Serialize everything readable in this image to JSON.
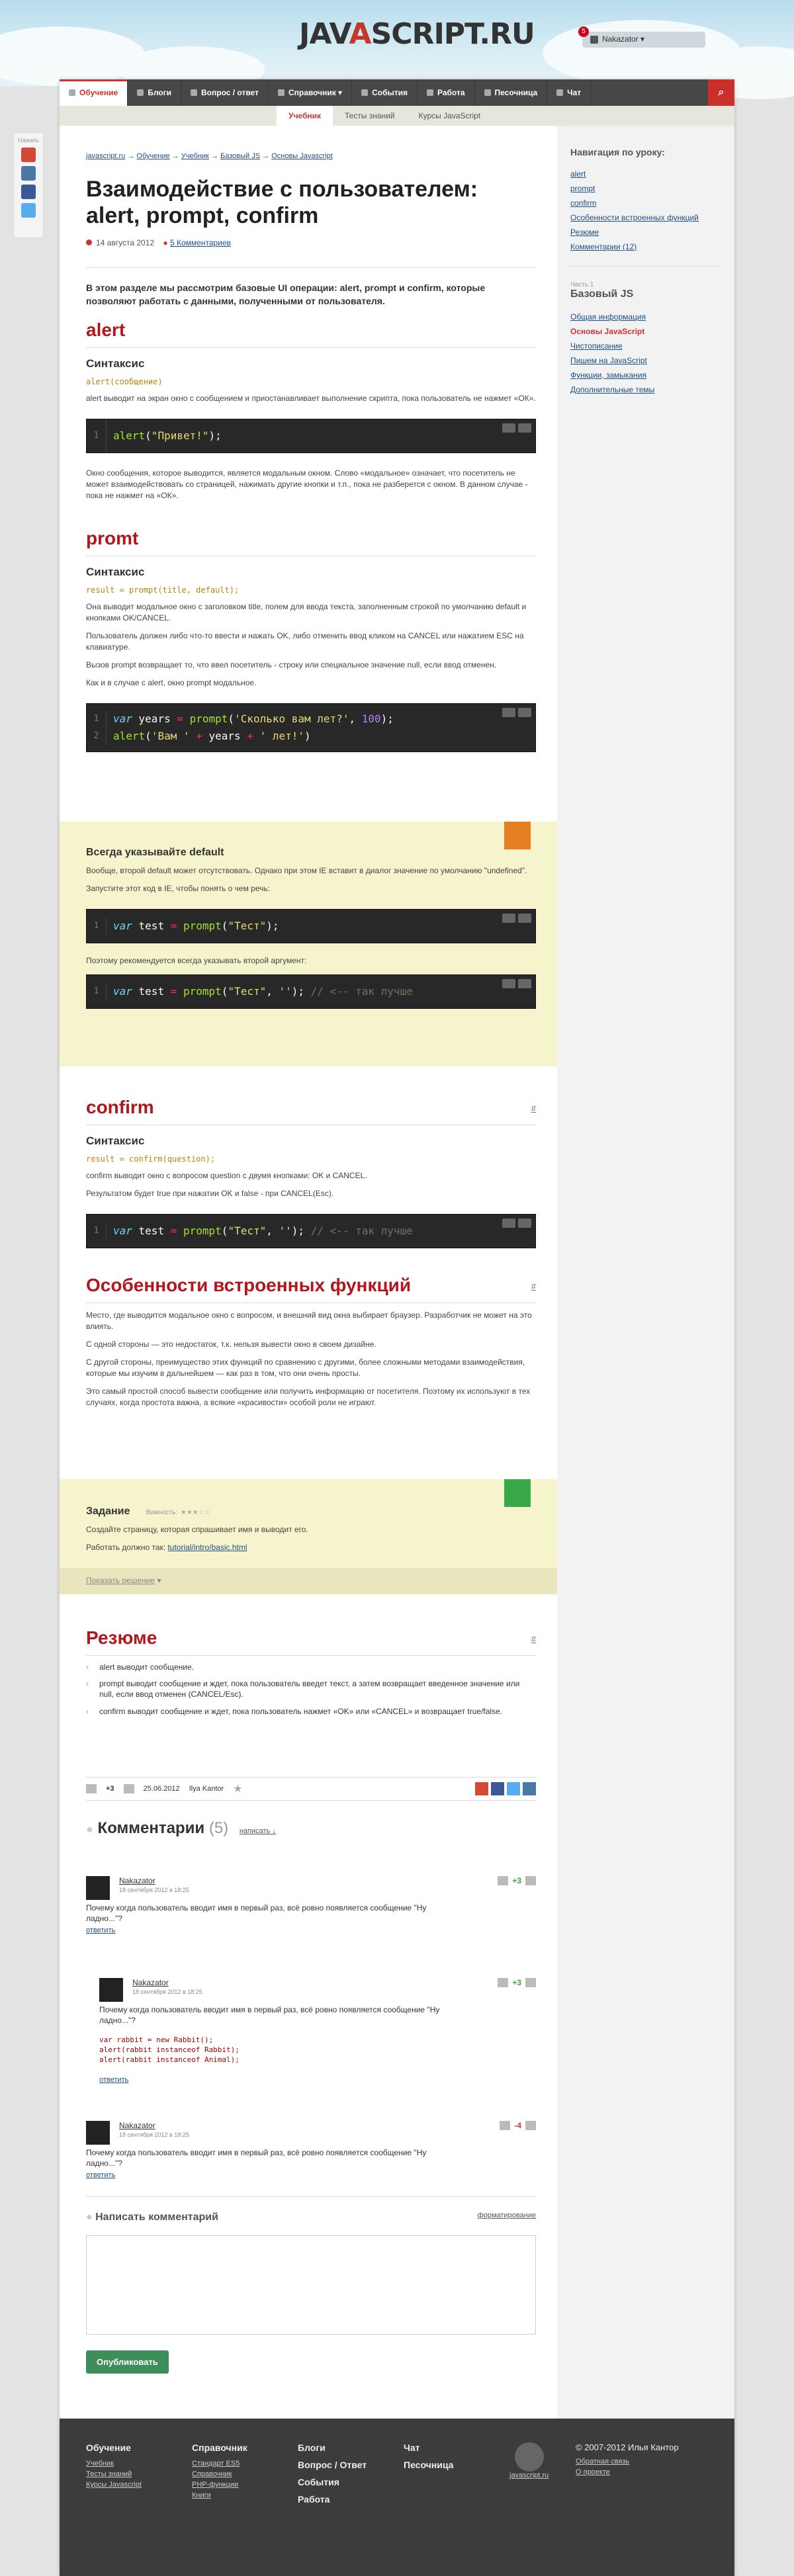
{
  "header": {
    "logo_prefix": "JAV",
    "logo_a": "A",
    "logo_suffix": "SCRIPT.RU",
    "user": "Nakazator",
    "notifications": "5"
  },
  "nav": [
    "Обучение",
    "Блоги",
    "Вопрос / ответ",
    "Справочник",
    "События",
    "Работа",
    "Песочница",
    "Чат"
  ],
  "subnav": [
    "Учебник",
    "Тесты знаний",
    "Курсы JavaScript"
  ],
  "share_label": "Нажать",
  "crumbs": [
    "javascript.ru",
    "Обучение",
    "Учебник",
    "Базовый JS",
    "Основы Javascript"
  ],
  "title": "Взаимодействие с пользователем: alert, prompt, confirm",
  "date": "14 августа 2012",
  "comments_link": "5 Комментариев",
  "intro": "В этом разделе мы рассмотрим базовые UI операции: alert, prompt и confirm, которые позволяют работать с данными, полученными от пользователя.",
  "alert": {
    "h": "alert",
    "syn_h": "Синтаксис",
    "syn": "alert(сообщение)",
    "p1": "alert выводит на экран окно с сообщением и приостанавливает выполнение скрипта, пока пользователь не нажмет «ОК».",
    "p2": "Окно сообщения, которое выводится, является модальным окном. Слово «модальное» означает, что посетитель не может взаимодействовать со страницей, нажимать другие кнопки и т.п., пока не разберется с окном. В данном случае - пока не нажмет на «ОК»."
  },
  "prompt": {
    "h": "promt",
    "syn_h": "Синтаксис",
    "syn": "result = prompt(title, default);",
    "p1": "Она выводит модальное окно с заголовком title, полем для ввода текста, заполненным строкой по умолчанию default и кнопками OK/CANCEL.",
    "p2": "Пользователь должен либо что-то ввести и нажать OK, либо отменить ввод кликом на CANCEL или нажатием ESC на клавиатуре.",
    "p3": "Вызов prompt возвращает то, что ввел посетитель - строку или специальное значение null, если ввод отменен.",
    "p4": "Как и в случае с alert, окно prompt модальное."
  },
  "warn": {
    "h": "Всегда указывайте default",
    "p1": "Вообще, второй default может отсутствовать. Однако при этом IE вставит в диалог значение по умолчанию \"undefined\".",
    "p2": "Запустите этот код в IE, чтобы понять о чем речь:",
    "p3": "Поэтому рекомендуется всегда указывать второй аргумент:"
  },
  "confirm": {
    "h": "confirm",
    "hash": "#",
    "syn_h": "Синтаксис",
    "syn": "result = confirm(question);",
    "p1": "confirm выводит окно с вопросом question с двумя кнопками: OK и CANCEL.",
    "p2": "Результатом будет true при нажатии OK и false - при CANCEL(Esc)."
  },
  "features": {
    "h": "Особенности встроенных функций",
    "hash": "#",
    "p1": "Место, где выводится модальное окно с вопросом, и внешний вид окна выбирает браузер. Разработчик не может на это влиять.",
    "p2": "С одной стороны — это недостаток, т.к. нельзя вывести окно в своем дизайне.",
    "p3": "С другой стороны, преимущество этих функций по сравнению с другими, более сложными методами взаимодействия, которые мы изучим в дальнейшем — как раз в том, что они очень просты.",
    "p4": "Это самый простой способ вывести сообщение или получить информацию от посетителя. Поэтому их используют в тех случаях, когда простота важна, а всякие «красивости» особой роли не играют."
  },
  "task": {
    "h": "Задание",
    "imp": "Важность:",
    "p1": "Создайте страницу, которая спрашивает имя и выводит его.",
    "p2": "Работать должно так:",
    "link": "tutorial/intro/basic.html",
    "show": "Показать решение"
  },
  "summary": {
    "h": "Резюме",
    "hash": "#",
    "items": [
      "alert выводит сообщение.",
      "prompt выводит сообщение и ждет, пока пользователь введет текст, а затем возвращает введенное значение или null, если ввод отменен (CANCEL/Esc).",
      "confirm выводит сообщение и ждет, пока пользователь нажмет «OK» или «CANCEL» и возвращает true/false."
    ]
  },
  "rating": {
    "score": "+3",
    "date": "25.06.2012",
    "author": "Ilya Kantor"
  },
  "comments": {
    "h": "Комментарии",
    "count": "(5)",
    "write": "написать ↓",
    "items": [
      {
        "user": "Nakazator",
        "date": "18 сентября 2012 в 18:25",
        "text": "Почему когда пользователь вводит имя в первый раз, всё ровно появляется сообщение \"Ну ладно...\"?",
        "reply": "ответить",
        "score": "+3"
      },
      {
        "user": "Nakazator",
        "date": "18 сентября 2012 в 18:25",
        "text": "Почему когда пользователь вводит имя в первый раз, всё ровно появляется сообщение \"Ну ладно...\"?",
        "code": [
          "var rabbit = new Rabbit();",
          "alert(rabbit instanceof Rabbit);",
          "alert(rabbit instanceof Animal);"
        ],
        "reply": "ответить",
        "score": "+3"
      },
      {
        "user": "Nakazator",
        "date": "18 сентября 2012 в 18:25",
        "text": "Почему когда пользователь вводит имя в первый раз, всё ровно появляется сообщение \"Ну ладно...\"?",
        "reply": "ответить",
        "score": "-4"
      }
    ]
  },
  "form": {
    "h": "Написать комментарий",
    "fmt": "форматирование",
    "submit": "Опубликовать"
  },
  "sidebar": {
    "title": "Навигация по уроку:",
    "links": [
      "alert",
      "prompt",
      "confirm",
      "Особенности встроенных функций",
      "Резюме",
      "Комментарии (12)"
    ],
    "chapter": "Часть 1",
    "chapter_title": "Базовый JS",
    "chapter_links": [
      "Общая информация",
      "Основы JavaScript",
      "Чистописание",
      "Пишем на JavaScript",
      "Функции, замыкания",
      "Дополнительные темы"
    ]
  },
  "footer": {
    "cols": [
      {
        "h": "Обучение",
        "links": [
          "Учебник",
          "Тесты знаний",
          "Курсы Javascript"
        ]
      },
      {
        "h": "Справочник",
        "links": [
          "Стандарт ES5",
          "Справочник",
          "PHP-функции",
          "Книги"
        ]
      },
      {
        "h": "Блоги",
        "links": []
      },
      {
        "h": "Вопрос / Ответ",
        "links": []
      },
      {
        "h": "События",
        "links": []
      },
      {
        "h": "Работа",
        "links": []
      },
      {
        "h": "Чат",
        "links": []
      },
      {
        "h": "Песочница",
        "links": []
      }
    ],
    "copy": "© 2007-2012 Илья Кантор",
    "links": [
      "Обратная связь",
      "О проекте"
    ],
    "counter": "javascript.ru"
  }
}
